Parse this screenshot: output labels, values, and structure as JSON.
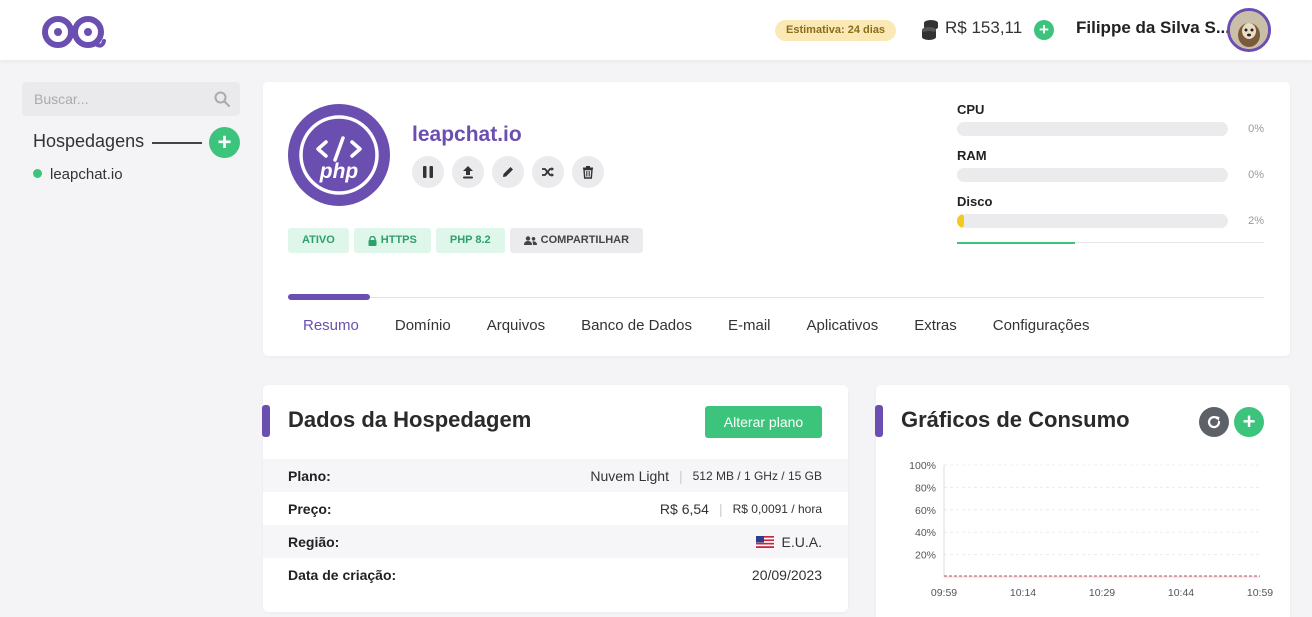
{
  "header": {
    "estimate": "Estimativa: 24 dias",
    "balance": "R$ 153,11",
    "username": "Filippe da Silva S..."
  },
  "sidebar": {
    "search_placeholder": "Buscar...",
    "section_title": "Hospedagens",
    "items": [
      {
        "label": "leapchat.io",
        "status": "active"
      }
    ]
  },
  "site": {
    "name": "leapchat.io",
    "logo_text": "php",
    "actions": [
      "pause-icon",
      "upload-icon",
      "pencil-icon",
      "shuffle-icon",
      "trash-icon"
    ],
    "badges": [
      {
        "label": "ATIVO",
        "style": "green"
      },
      {
        "label": "HTTPS",
        "style": "green",
        "icon": "lock-icon"
      },
      {
        "label": "PHP 8.2",
        "style": "green"
      },
      {
        "label": "COMPARTILHAR",
        "style": "gray",
        "icon": "users-icon"
      }
    ]
  },
  "metrics": [
    {
      "label": "CPU",
      "value": "0%",
      "fraction": 0
    },
    {
      "label": "RAM",
      "value": "0%",
      "fraction": 0
    },
    {
      "label": "Disco",
      "value": "2%",
      "fraction": 0.02
    }
  ],
  "tabs": [
    "Resumo",
    "Domínio",
    "Arquivos",
    "Banco de Dados",
    "E-mail",
    "Aplicativos",
    "Extras",
    "Configurações"
  ],
  "active_tab": "Resumo",
  "dados": {
    "title": "Dados da Hospedagem",
    "button": "Alterar plano",
    "rows": [
      {
        "label": "Plano:",
        "value": "Nuvem Light",
        "extra": "512 MB / 1 GHz / 15 GB"
      },
      {
        "label": "Preço:",
        "value": "R$ 6,54",
        "extra": "R$ 0,0091 / hora"
      },
      {
        "label": "Região:",
        "value": "E.U.A.",
        "flag": "us-flag-icon"
      },
      {
        "label": "Data de criação:",
        "value": "20/09/2023"
      }
    ]
  },
  "graficos": {
    "title": "Gráficos de Consumo"
  },
  "chart_data": {
    "type": "line",
    "y_ticks": [
      "100%",
      "80%",
      "60%",
      "40%",
      "20%"
    ],
    "x_ticks": [
      "09:59",
      "10:14",
      "10:29",
      "10:44",
      "10:59"
    ],
    "ylim": [
      0,
      100
    ],
    "series": [
      {
        "values": [
          0,
          0,
          0,
          0,
          0
        ]
      }
    ],
    "colors": {
      "series": "#e06a78"
    },
    "grid": true
  },
  "colors": {
    "brand": "#6a4fb0",
    "success": "#3cc47c",
    "warning": "#f4c91f"
  }
}
